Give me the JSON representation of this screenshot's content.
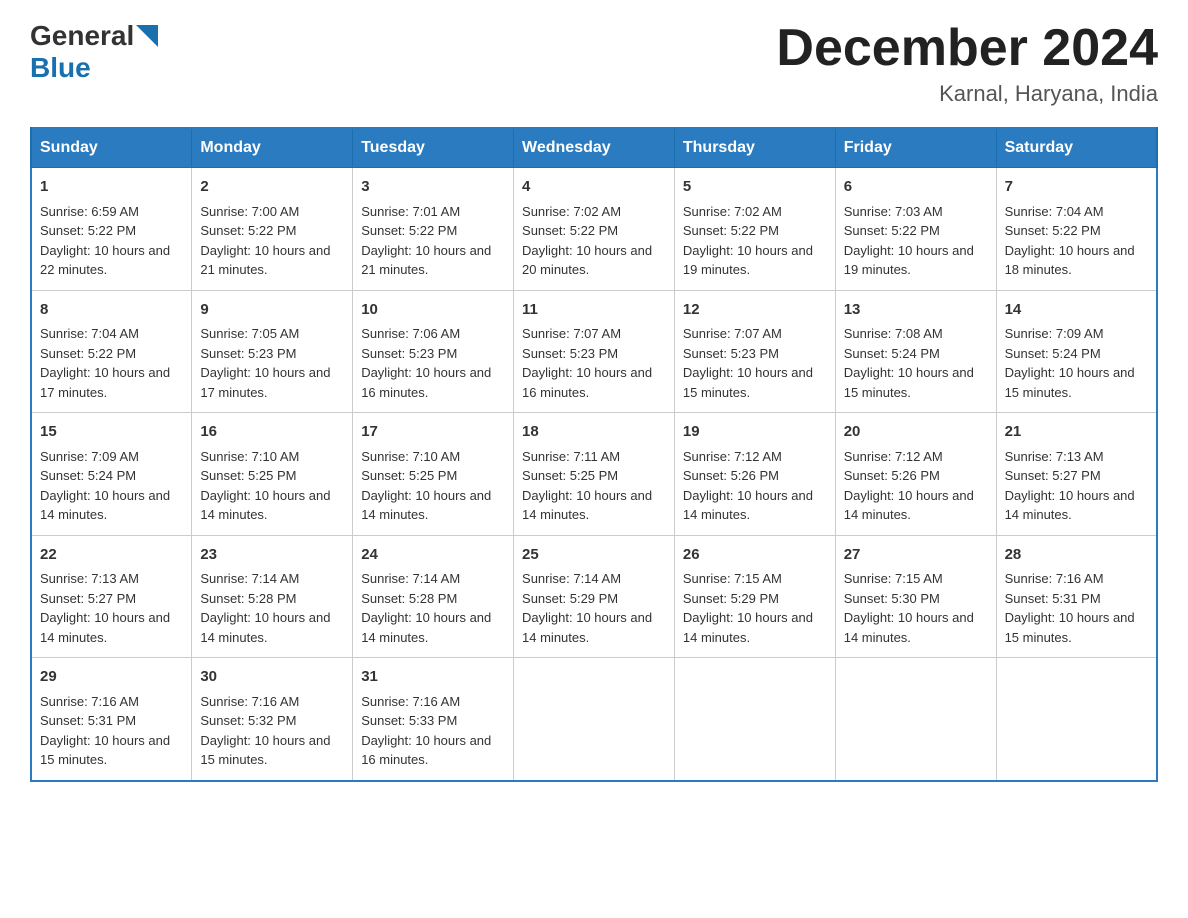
{
  "header": {
    "logo_general": "General",
    "logo_blue": "Blue",
    "month_title": "December 2024",
    "location": "Karnal, Haryana, India"
  },
  "days_of_week": [
    "Sunday",
    "Monday",
    "Tuesday",
    "Wednesday",
    "Thursday",
    "Friday",
    "Saturday"
  ],
  "weeks": [
    [
      {
        "num": "1",
        "sunrise": "6:59 AM",
        "sunset": "5:22 PM",
        "daylight": "10 hours and 22 minutes."
      },
      {
        "num": "2",
        "sunrise": "7:00 AM",
        "sunset": "5:22 PM",
        "daylight": "10 hours and 21 minutes."
      },
      {
        "num": "3",
        "sunrise": "7:01 AM",
        "sunset": "5:22 PM",
        "daylight": "10 hours and 21 minutes."
      },
      {
        "num": "4",
        "sunrise": "7:02 AM",
        "sunset": "5:22 PM",
        "daylight": "10 hours and 20 minutes."
      },
      {
        "num": "5",
        "sunrise": "7:02 AM",
        "sunset": "5:22 PM",
        "daylight": "10 hours and 19 minutes."
      },
      {
        "num": "6",
        "sunrise": "7:03 AM",
        "sunset": "5:22 PM",
        "daylight": "10 hours and 19 minutes."
      },
      {
        "num": "7",
        "sunrise": "7:04 AM",
        "sunset": "5:22 PM",
        "daylight": "10 hours and 18 minutes."
      }
    ],
    [
      {
        "num": "8",
        "sunrise": "7:04 AM",
        "sunset": "5:22 PM",
        "daylight": "10 hours and 17 minutes."
      },
      {
        "num": "9",
        "sunrise": "7:05 AM",
        "sunset": "5:23 PM",
        "daylight": "10 hours and 17 minutes."
      },
      {
        "num": "10",
        "sunrise": "7:06 AM",
        "sunset": "5:23 PM",
        "daylight": "10 hours and 16 minutes."
      },
      {
        "num": "11",
        "sunrise": "7:07 AM",
        "sunset": "5:23 PM",
        "daylight": "10 hours and 16 minutes."
      },
      {
        "num": "12",
        "sunrise": "7:07 AM",
        "sunset": "5:23 PM",
        "daylight": "10 hours and 15 minutes."
      },
      {
        "num": "13",
        "sunrise": "7:08 AM",
        "sunset": "5:24 PM",
        "daylight": "10 hours and 15 minutes."
      },
      {
        "num": "14",
        "sunrise": "7:09 AM",
        "sunset": "5:24 PM",
        "daylight": "10 hours and 15 minutes."
      }
    ],
    [
      {
        "num": "15",
        "sunrise": "7:09 AM",
        "sunset": "5:24 PM",
        "daylight": "10 hours and 14 minutes."
      },
      {
        "num": "16",
        "sunrise": "7:10 AM",
        "sunset": "5:25 PM",
        "daylight": "10 hours and 14 minutes."
      },
      {
        "num": "17",
        "sunrise": "7:10 AM",
        "sunset": "5:25 PM",
        "daylight": "10 hours and 14 minutes."
      },
      {
        "num": "18",
        "sunrise": "7:11 AM",
        "sunset": "5:25 PM",
        "daylight": "10 hours and 14 minutes."
      },
      {
        "num": "19",
        "sunrise": "7:12 AM",
        "sunset": "5:26 PM",
        "daylight": "10 hours and 14 minutes."
      },
      {
        "num": "20",
        "sunrise": "7:12 AM",
        "sunset": "5:26 PM",
        "daylight": "10 hours and 14 minutes."
      },
      {
        "num": "21",
        "sunrise": "7:13 AM",
        "sunset": "5:27 PM",
        "daylight": "10 hours and 14 minutes."
      }
    ],
    [
      {
        "num": "22",
        "sunrise": "7:13 AM",
        "sunset": "5:27 PM",
        "daylight": "10 hours and 14 minutes."
      },
      {
        "num": "23",
        "sunrise": "7:14 AM",
        "sunset": "5:28 PM",
        "daylight": "10 hours and 14 minutes."
      },
      {
        "num": "24",
        "sunrise": "7:14 AM",
        "sunset": "5:28 PM",
        "daylight": "10 hours and 14 minutes."
      },
      {
        "num": "25",
        "sunrise": "7:14 AM",
        "sunset": "5:29 PM",
        "daylight": "10 hours and 14 minutes."
      },
      {
        "num": "26",
        "sunrise": "7:15 AM",
        "sunset": "5:29 PM",
        "daylight": "10 hours and 14 minutes."
      },
      {
        "num": "27",
        "sunrise": "7:15 AM",
        "sunset": "5:30 PM",
        "daylight": "10 hours and 14 minutes."
      },
      {
        "num": "28",
        "sunrise": "7:16 AM",
        "sunset": "5:31 PM",
        "daylight": "10 hours and 15 minutes."
      }
    ],
    [
      {
        "num": "29",
        "sunrise": "7:16 AM",
        "sunset": "5:31 PM",
        "daylight": "10 hours and 15 minutes."
      },
      {
        "num": "30",
        "sunrise": "7:16 AM",
        "sunset": "5:32 PM",
        "daylight": "10 hours and 15 minutes."
      },
      {
        "num": "31",
        "sunrise": "7:16 AM",
        "sunset": "5:33 PM",
        "daylight": "10 hours and 16 minutes."
      },
      null,
      null,
      null,
      null
    ]
  ]
}
